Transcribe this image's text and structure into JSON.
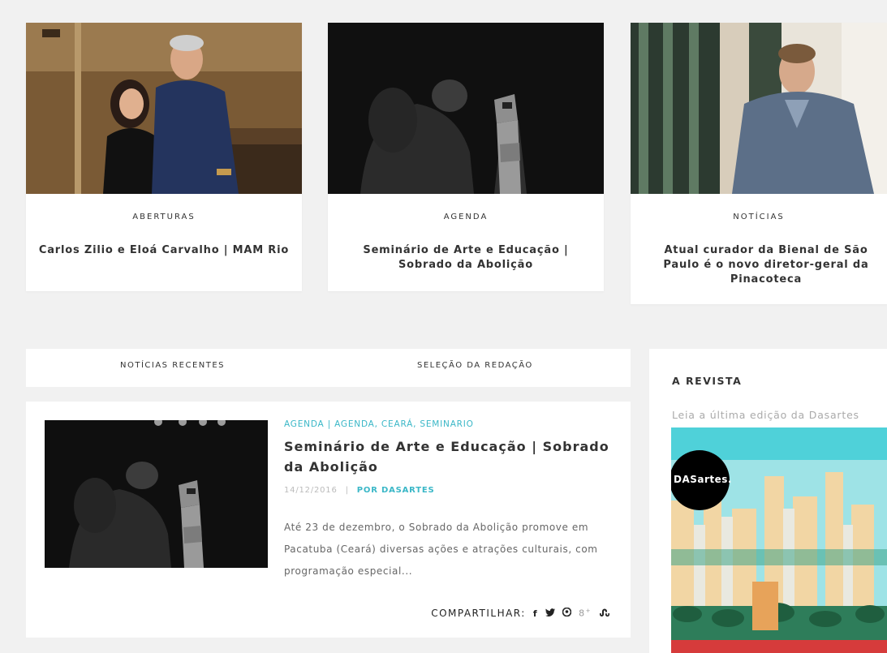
{
  "featured": [
    {
      "category": "ABERTURAS",
      "title": "Carlos Zilio e Eloá Carvalho | MAM Rio"
    },
    {
      "category": "AGENDA",
      "title": "Seminário de Arte e Educação | Sobrado da Abolição"
    },
    {
      "category": "NOTÍCIAS",
      "title": "Atual curador da Bienal de São Paulo é o novo diretor-geral da Pinacoteca"
    }
  ],
  "tabs": {
    "recent": "NOTÍCIAS RECENTES",
    "editors": "SELEÇÃO DA REDAÇÃO"
  },
  "post": {
    "categories": "AGENDA | AGENDA, CEARÁ, SEMINARIO",
    "title": "Seminário de Arte e Educação | Sobrado da Abolição",
    "date": "14/12/2016",
    "separator": "|",
    "author": "POR DASARTES",
    "excerpt": "Até 23 de dezembro, o Sobrado da Abolição promove em Pacatuba (Ceará) diversas ações e atrações culturais, com programação especial...",
    "share_label": "COMPARTILHAR:",
    "share_icons": [
      "facebook-icon",
      "twitter-icon",
      "pinterest-icon",
      "google-plus-icon",
      "stumbleupon-icon"
    ]
  },
  "sidebar": {
    "title": "A REVISTA",
    "text": "Leia a última edição da Dasartes",
    "cover_logo": "DASartes."
  },
  "colors": {
    "accent": "#3ab7c7",
    "background": "#f1f1f1"
  }
}
